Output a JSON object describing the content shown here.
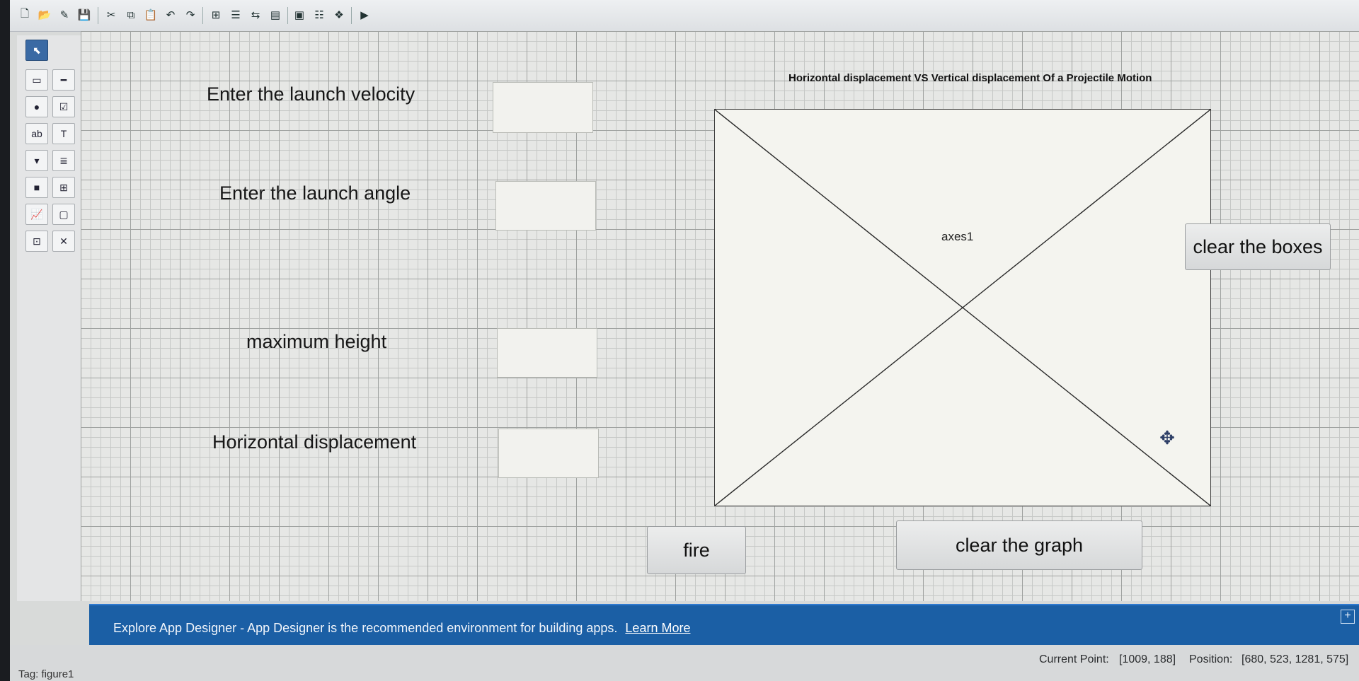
{
  "toolbar": {
    "icons": [
      "new-file-icon",
      "open-folder-icon",
      "edit-icon",
      "save-icon",
      "cut-icon",
      "copy-icon",
      "paste-icon",
      "undo-icon",
      "redo-icon",
      "align-icon",
      "menu-editor-icon",
      "tab-order-icon",
      "toolbar-editor-icon",
      "editor-icon",
      "property-inspector-icon",
      "object-browser-icon",
      "run-icon"
    ]
  },
  "palette": {
    "tools": [
      "select-tool-icon",
      "push-button-icon",
      "slider-icon",
      "radio-button-icon",
      "check-box-icon",
      "edit-text-icon",
      "static-text-icon",
      "popup-menu-icon",
      "listbox-icon",
      "toggle-button-icon",
      "table-icon",
      "axes-icon",
      "panel-icon",
      "button-group-icon",
      "activex-icon"
    ]
  },
  "form": {
    "launch_velocity_label": "Enter the launch velocity",
    "launch_angle_label": "Enter the launch angle",
    "max_height_label": "maximum height",
    "horizontal_displacement_label": "Horizontal displacement"
  },
  "axes": {
    "title": "Horizontal displacement VS Vertical displacement Of a Projectile Motion",
    "tag": "axes1"
  },
  "buttons": {
    "clear_boxes": "clear the boxes",
    "fire": "fire",
    "clear_graph": "clear the graph"
  },
  "banner": {
    "message": "Explore App Designer - App Designer is the recommended environment for building apps.",
    "link": "Learn More"
  },
  "status": {
    "tag": "Tag: figure1",
    "current_point_label": "Current Point:",
    "current_point_value": "[1009, 188]",
    "position_label": "Position:",
    "position_value": "[680, 523, 1281, 575]"
  }
}
